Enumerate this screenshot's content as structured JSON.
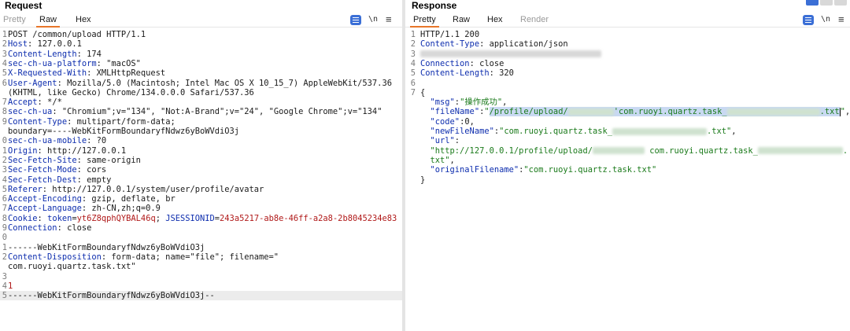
{
  "request": {
    "title": "Request",
    "tabs": [
      {
        "label": "Pretty",
        "state": "dim"
      },
      {
        "label": "Raw",
        "state": "active"
      },
      {
        "label": "Hex",
        "state": "normal"
      }
    ],
    "toolbar": {
      "newline_label": "\\n",
      "menu_label": "≡"
    },
    "lines": [
      {
        "n": "1",
        "html": "POST /common/upload HTTP/1.1"
      },
      {
        "n": "2",
        "html": "<span class='k'>Host</span>: 127.0.0.1"
      },
      {
        "n": "3",
        "html": "<span class='k'>Content-Length</span>: 174"
      },
      {
        "n": "4",
        "html": "<span class='k'>sec-ch-ua-platform</span>: \"macOS\""
      },
      {
        "n": "5",
        "html": "<span class='k'>X-Requested-With</span>: XMLHttpRequest"
      },
      {
        "n": "6",
        "html": "<span class='k'>User-Agent</span>: Mozilla/5.0 (Macintosh; Intel Mac OS X 10_15_7) AppleWebKit/537.36"
      },
      {
        "n": "",
        "html": "(KHTML, like Gecko) Chrome/134.0.0.0 Safari/537.36"
      },
      {
        "n": "7",
        "html": "<span class='k'>Accept</span>: */*"
      },
      {
        "n": "8",
        "html": "<span class='k'>sec-ch-ua</span>: \"Chromium\";v=\"134\", \"Not:A-Brand\";v=\"24\", \"Google Chrome\";v=\"134\""
      },
      {
        "n": "9",
        "html": "<span class='k'>Content-Type</span>: multipart/form-data;"
      },
      {
        "n": "",
        "html": "boundary=----WebKitFormBoundaryfNdwz6yBoWVdiO3j"
      },
      {
        "n": "0",
        "html": "<span class='k'>sec-ch-ua-mobile</span>: ?0"
      },
      {
        "n": "1",
        "html": "<span class='k'>Origin</span>: http://127.0.0.1"
      },
      {
        "n": "2",
        "html": "<span class='k'>Sec-Fetch-Site</span>: same-origin"
      },
      {
        "n": "3",
        "html": "<span class='k'>Sec-Fetch-Mode</span>: cors"
      },
      {
        "n": "4",
        "html": "<span class='k'>Sec-Fetch-Dest</span>: empty"
      },
      {
        "n": "5",
        "html": "<span class='k'>Referer</span>: http://127.0.0.1/system/user/profile/avatar"
      },
      {
        "n": "6",
        "html": "<span class='k'>Accept-Encoding</span>: gzip, deflate, br"
      },
      {
        "n": "7",
        "html": "<span class='k'>Accept-Language</span>: zh-CN,zh;q=0.9"
      },
      {
        "n": "8",
        "html": "<span class='k'>Cookie</span>: <span class='k'>token</span>=<span class='kr'>yt6Z8qphQYBAL46q</span>; <span class='k'>JSESSIONID</span>=<span class='kr'>243a5217-ab8e-46ff-a2a8-2b8045234e83</span>"
      },
      {
        "n": "9",
        "html": "<span class='k'>Connection</span>: close"
      },
      {
        "n": "0",
        "html": ""
      },
      {
        "n": "1",
        "html": "------WebKitFormBoundaryfNdwz6yBoWVdiO3j"
      },
      {
        "n": "2",
        "html": "<span class='k'>Content-Disposition</span>: form-data; name=\"file\"; filename=\""
      },
      {
        "n": "",
        "html": "com.ruoyi.quartz.task.txt\""
      },
      {
        "n": "3",
        "html": ""
      },
      {
        "n": "4",
        "html": "<span class='kr'>1</span>"
      },
      {
        "n": "5",
        "html": "------WebKitFormBoundaryfNdwz6yBoWVdiO3j--",
        "highlight": true
      }
    ]
  },
  "response": {
    "title": "Response",
    "tabs": [
      {
        "label": "Pretty",
        "state": "active"
      },
      {
        "label": "Raw",
        "state": "normal"
      },
      {
        "label": "Hex",
        "state": "normal"
      },
      {
        "label": "Render",
        "state": "dim"
      }
    ],
    "toolbar": {
      "newline_label": "\\n",
      "menu_label": "≡"
    },
    "lines": [
      {
        "n": "1",
        "html": "HTTP/1.1 200"
      },
      {
        "n": "2",
        "html": "<span class='k'>Content-Type</span>: application/json"
      },
      {
        "n": "3",
        "html": "<span class='blur grey' style='width:230px'></span>"
      },
      {
        "n": "4",
        "html": "<span class='k'>Connection</span>: close"
      },
      {
        "n": "5",
        "html": "<span class='k'>Content-Length</span>: 320"
      },
      {
        "n": "6",
        "html": ""
      },
      {
        "n": "7",
        "html": "{"
      },
      {
        "n": "",
        "html": "  <span class='k'>\"msg\"</span>:<span class='s'>\"操作成功\"</span>,"
      },
      {
        "n": "",
        "html": "  <span class='k'>\"fileName\"</span>:<span class='s'>\"<span class='sel'>/profile/upload/<span class='blur' style='width:58px'></span>'com.ruoyi.quartz.task_<span class='blur' style='width:118px'></span>.txt</span></span><span class='caret'></span><span class='s'>\"</span>,"
      },
      {
        "n": "",
        "html": "  <span class='k'>\"code\"</span>:0,"
      },
      {
        "n": "",
        "html": "  <span class='k'>\"newFileName\"</span>:<span class='s'>\"com.ruoyi.quartz.task_<span class='blur' style='width:120px'></span>.txt\"</span>,"
      },
      {
        "n": "",
        "html": "  <span class='k'>\"url\"</span>:"
      },
      {
        "n": "",
        "html": "  <span class='s'>\"http://127.0.0.1/profile/upload/<span class='blur' style='width:66px'></span> com.ruoyi.quartz.task_<span class='blur' style='width:108px'></span>.</span>"
      },
      {
        "n": "",
        "html": "  <span class='s'>txt\"</span>,"
      },
      {
        "n": "",
        "html": "  <span class='k'>\"originalFilename\"</span>:<span class='s'>\"com.ruoyi.quartz.task.txt\"</span>"
      },
      {
        "n": "",
        "html": "}"
      }
    ]
  }
}
